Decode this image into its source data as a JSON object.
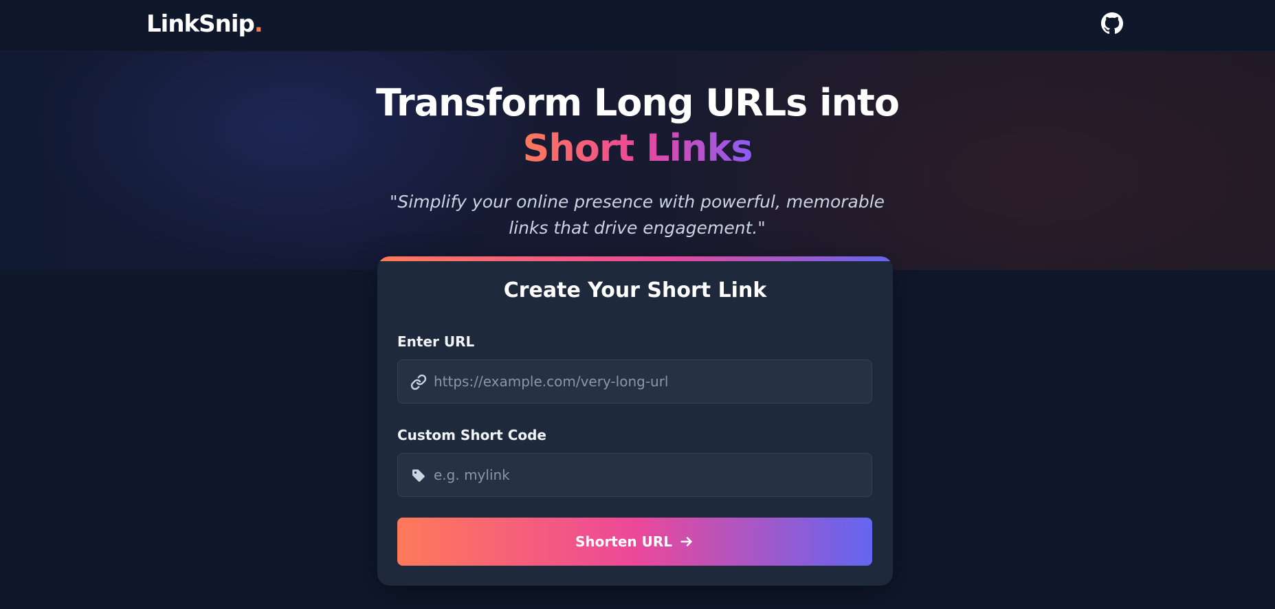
{
  "header": {
    "logo_text": "LinkSnip",
    "logo_dot": ".",
    "github_icon": "github-icon"
  },
  "hero": {
    "title_line1": "Transform Long URLs into",
    "title_line2": "Short Links",
    "subtitle": "\"Simplify your online presence with powerful, memorable links that drive engagement.\""
  },
  "form": {
    "title": "Create Your Short Link",
    "url_label": "Enter URL",
    "url_placeholder": "https://example.com/very-long-url",
    "url_value": "",
    "url_icon": "link-icon",
    "code_label": "Custom Short Code",
    "code_placeholder": "e.g. mylink",
    "code_value": "",
    "code_icon": "tag-icon",
    "submit_label": "Shorten URL",
    "submit_icon": "arrow-right-icon"
  },
  "colors": {
    "background": "#0f172a",
    "card": "#1e293b",
    "input": "#263244",
    "accent_orange": "#ff7a59",
    "accent_pink": "#ec4899",
    "accent_violet": "#6366f1"
  }
}
